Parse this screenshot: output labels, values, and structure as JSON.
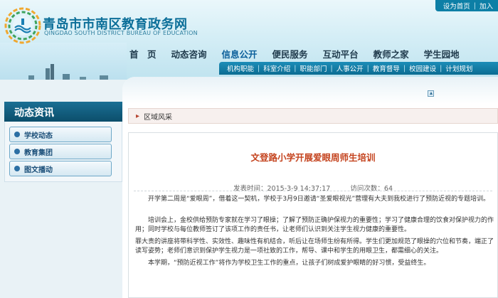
{
  "header": {
    "title": "青岛市市南区教育政务网",
    "subtitle": "QINGDAO SOUTH DISTRICT BUREAU OF EDUCATION",
    "top_links": [
      "设为首页",
      "加入"
    ]
  },
  "nav": {
    "items": [
      "首　页",
      "动态咨询",
      "信息公开",
      "便民服务",
      "互动平台",
      "教师之家",
      "学生园地"
    ],
    "active_index": 2
  },
  "subnav": {
    "items": [
      "机构职能",
      "科室介绍",
      "职能部门",
      "人事公开",
      "教育督导",
      "校园建设",
      "计划规划"
    ]
  },
  "sidebar": {
    "title": "动态资讯",
    "items": [
      "学校动态",
      "教育集团",
      "图文播动"
    ]
  },
  "breadcrumb": {
    "label": "区域风采"
  },
  "article": {
    "title": "文登路小学开展爱眼周师生培训",
    "meta_time_label": "发表时间：",
    "meta_time": "2015-3-9 14:37:17",
    "meta_views_label": "访问次数：",
    "meta_views": "64",
    "paragraphs": [
      "开学第二周是“爱眼周”，借着这一契机，学校于3月9日邀请“圣爱眼视光”营理有大夫到我校进行了预防近视的专题培训。",
      "培训会上，金校供给预防专家就在学习了眼操；了解了预防正确护保视力的重要性；学习了健康合理的饮食对保护视力的作用；同时学校与每位教师签订了该项工作的责任书，让老师们认识到关注学生视力健康的重要性。",
      "罪大责的讲座将带科学性、实效性、趣味性有机结合，听后让在场师生纷有所得。学生们更加规范了眼操的穴位和节奏，端正了读写姿势；老师们意识到保护学生视力是一项社致的工作，帮导、课中和学生的用眼卫生，都需细心的关注。",
      "本学期，“预防近视工作”将作为学校卫生工作的重点，让孩子们树成爱护眼睛的好习惯，受益终生。"
    ]
  },
  "colors": {
    "brand": "#0c6f99",
    "subnav": "#0b6c92",
    "title_red": "#c4431e"
  }
}
